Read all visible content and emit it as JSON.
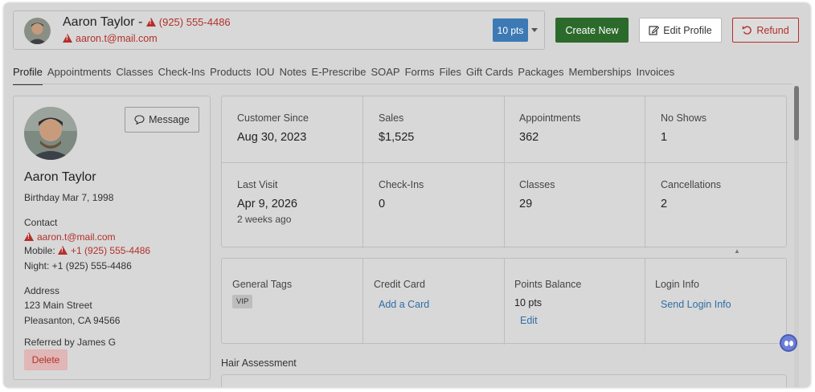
{
  "header": {
    "name": "Aaron Taylor -",
    "phone": "(925) 555-4486",
    "email": "aaron.t@mail.com",
    "points_button": "10 pts",
    "create_new": "Create New",
    "edit_profile": "Edit Profile",
    "refund": "Refund"
  },
  "tabs": [
    "Profile",
    "Appointments",
    "Classes",
    "Check-Ins",
    "Products",
    "IOU",
    "Notes",
    "E-Prescribe",
    "SOAP",
    "Forms",
    "Files",
    "Gift Cards",
    "Packages",
    "Memberships",
    "Invoices"
  ],
  "active_tab": "Profile",
  "profile": {
    "message_button": "Message",
    "name": "Aaron Taylor",
    "birthday": "Birthday Mar 7, 1998",
    "contact_heading": "Contact",
    "email": "aaron.t@mail.com",
    "mobile_label": "Mobile:",
    "mobile": "+1 (925) 555-4486",
    "night": "Night: +1 (925) 555-4486",
    "address_heading": "Address",
    "address_line1": "123 Main Street",
    "address_line2": "Pleasanton, CA 94566",
    "referred_by": "Referred by James G",
    "delete_button": "Delete"
  },
  "stats": [
    {
      "label": "Customer Since",
      "value": "Aug 30, 2023",
      "sub": ""
    },
    {
      "label": "Sales",
      "value": "$1,525",
      "sub": ""
    },
    {
      "label": "Appointments",
      "value": "362",
      "sub": ""
    },
    {
      "label": "No Shows",
      "value": "1",
      "sub": ""
    },
    {
      "label": "Last Visit",
      "value": "Apr 9, 2026",
      "sub": "2 weeks ago"
    },
    {
      "label": "Check-Ins",
      "value": "0",
      "sub": ""
    },
    {
      "label": "Classes",
      "value": "29",
      "sub": ""
    },
    {
      "label": "Cancellations",
      "value": "2",
      "sub": ""
    }
  ],
  "info": {
    "general_tags_label": "General Tags",
    "tag": "VIP",
    "credit_card_label": "Credit Card",
    "add_card_link": "Add a Card",
    "points_label": "Points Balance",
    "points_value": "10 pts",
    "points_edit": "Edit",
    "login_label": "Login Info",
    "send_login_link": "Send Login Info"
  },
  "hair_assessment_title": "Hair Assessment",
  "colors": {
    "accent_green": "#2c6a2c",
    "accent_blue": "#3d7ab5",
    "alert_red": "#b3302a",
    "link_blue": "#2f6ea8"
  },
  "icons": {
    "warning": "warning-triangle-icon",
    "edit": "pencil-square-icon",
    "refund": "undo-arrow-icon",
    "message": "speech-bubble-icon",
    "dropdown": "caret-down-icon",
    "assistant": "assistant-bot-icon"
  }
}
